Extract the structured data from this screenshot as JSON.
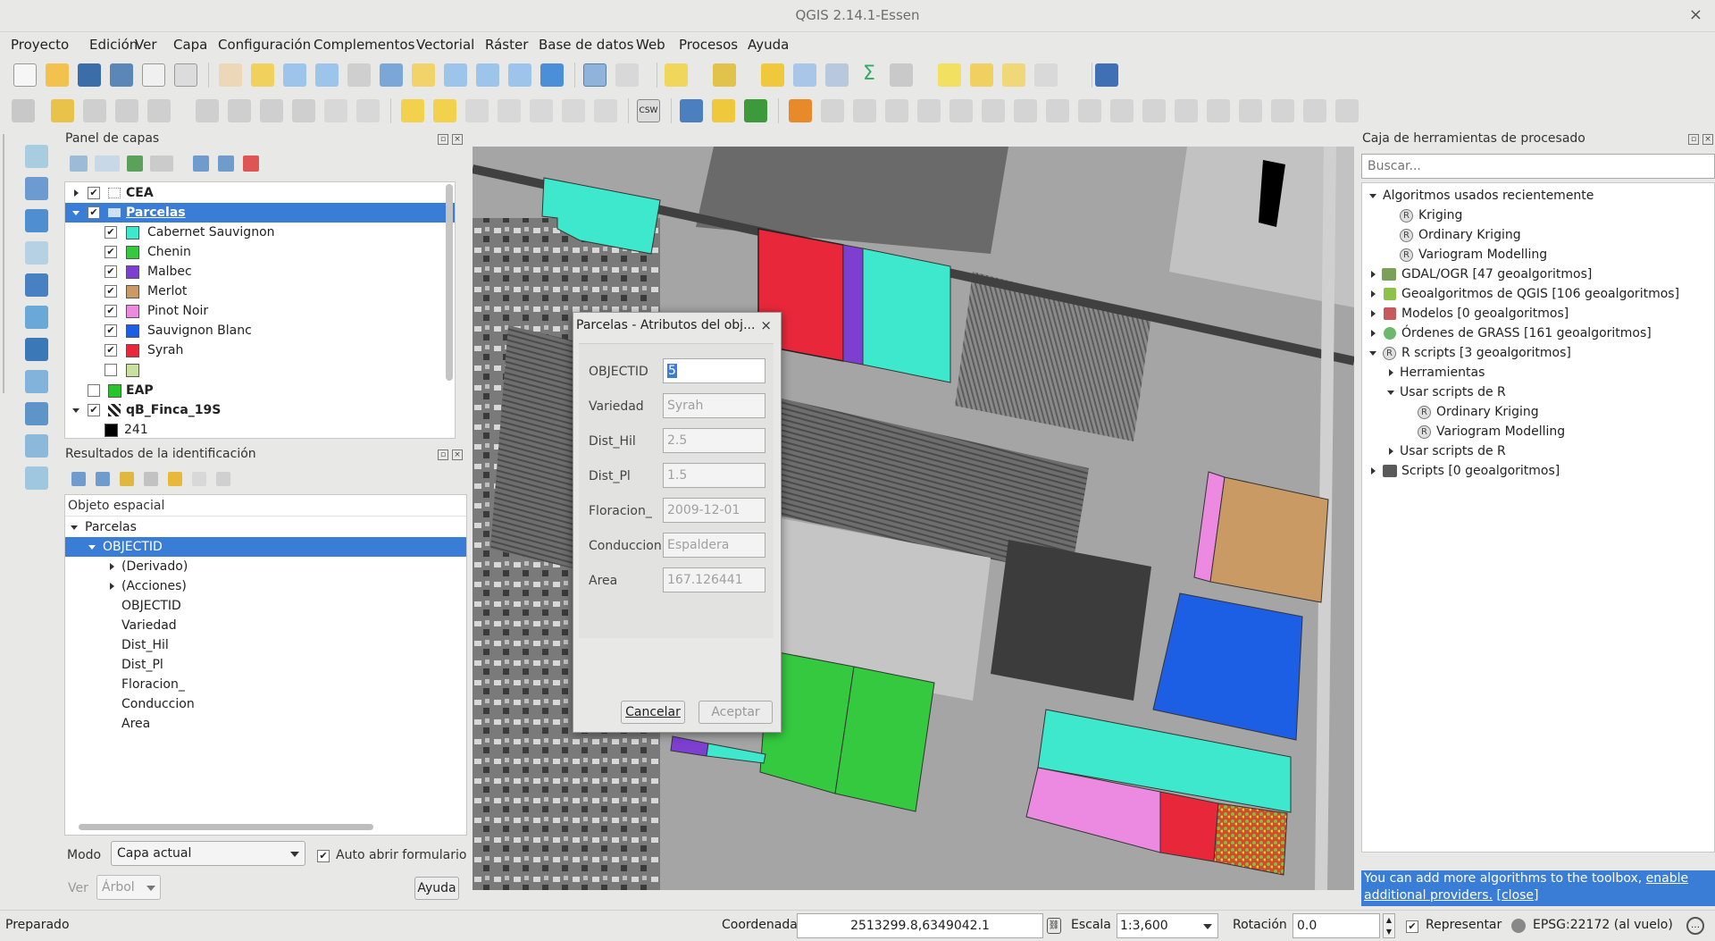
{
  "window": {
    "title": "QGIS 2.14.1-Essen",
    "close_glyph": "×"
  },
  "menu": [
    "Proyecto",
    "Edición",
    "Ver",
    "Capa",
    "Configuración",
    "Complementos",
    "Vectorial",
    "Ráster",
    "Base de datos",
    "Web",
    "Procesos",
    "Ayuda"
  ],
  "layers_panel": {
    "title": "Panel de capas",
    "layers": [
      {
        "name": "CEA",
        "checked": true,
        "expanded": false
      },
      {
        "name": "Parcelas",
        "checked": true,
        "expanded": true,
        "selected": true
      },
      {
        "name": "EAP",
        "checked": false
      },
      {
        "name": "qB_Finca_19S",
        "checked": true,
        "expanded": true
      }
    ],
    "legend": [
      {
        "label": "Cabernet Sauvignon",
        "color": "#3de8cc",
        "checked": true
      },
      {
        "label": "Chenin",
        "color": "#34c93f",
        "checked": true
      },
      {
        "label": "Malbec",
        "color": "#7d3fd0",
        "checked": true
      },
      {
        "label": "Merlot",
        "color": "#c99a64",
        "checked": true
      },
      {
        "label": "Pinot Noir",
        "color": "#ec89e0",
        "checked": true
      },
      {
        "label": "Sauvignon Blanc",
        "color": "#1d5fe4",
        "checked": true
      },
      {
        "label": "Syrah",
        "color": "#e8283a",
        "checked": true
      },
      {
        "label": "",
        "color": "#c8e0a0",
        "checked": false
      }
    ],
    "eap_color": "#27c42c",
    "raster_value": "241"
  },
  "identify_panel": {
    "title": "Resultados de la identificación",
    "header": "Objeto espacial",
    "layer": "Parcelas",
    "selected_field": "OBJECTID",
    "children": [
      "(Derivado)",
      "(Acciones)"
    ],
    "fields": [
      "OBJECTID",
      "Variedad",
      "Dist_Hil",
      "Dist_Pl",
      "Floracion_",
      "Conduccion",
      "Area"
    ],
    "mode_label": "Modo",
    "mode_value": "Capa actual",
    "auto_open_label": "Auto abrir formulario",
    "auto_open_checked": true,
    "view_label": "Ver",
    "view_value": "Árbol",
    "help_button": "Ayuda"
  },
  "dialog": {
    "title": "Parcelas - Atributos del obj...",
    "close_glyph": "×",
    "fields": [
      {
        "label": "OBJECTID",
        "value": "5"
      },
      {
        "label": "Variedad",
        "value": "Syrah"
      },
      {
        "label": "Dist_Hil",
        "value": "2.5"
      },
      {
        "label": "Dist_Pl",
        "value": "1.5"
      },
      {
        "label": "Floracion_",
        "value": "2009-12-01"
      },
      {
        "label": "Conduccion",
        "value": "Espaldera"
      },
      {
        "label": "Area",
        "value": "167.126441"
      }
    ],
    "cancel": "Cancelar",
    "accept": "Aceptar"
  },
  "processing_panel": {
    "title": "Caja de herramientas de procesado",
    "search_placeholder": "Buscar...",
    "tree": [
      {
        "label": "Algoritmos usados recientemente",
        "level": 0,
        "expanded": true
      },
      {
        "label": "Kriging",
        "level": 2
      },
      {
        "label": "Ordinary Kriging",
        "level": 2
      },
      {
        "label": "Variogram Modelling",
        "level": 2
      },
      {
        "label": "GDAL/OGR [47 geoalgoritmos]",
        "level": 0,
        "expanded": false
      },
      {
        "label": "Geoalgoritmos de QGIS [106 geoalgoritmos]",
        "level": 0,
        "expanded": false
      },
      {
        "label": "Modelos [0 geoalgoritmos]",
        "level": 0,
        "expanded": false
      },
      {
        "label": "Órdenes de GRASS [161 geoalgoritmos]",
        "level": 0,
        "expanded": false
      },
      {
        "label": "R scripts [3 geoalgoritmos]",
        "level": 0,
        "expanded": true
      },
      {
        "label": "Herramientas",
        "level": 1,
        "expanded": false
      },
      {
        "label": "Usar scripts de R",
        "level": 1,
        "expanded": true
      },
      {
        "label": "Ordinary Kriging",
        "level": 3
      },
      {
        "label": "Variogram Modelling",
        "level": 3
      },
      {
        "label": "Usar scripts de R",
        "level": 1,
        "expanded": false
      },
      {
        "label": "Scripts [0 geoalgoritmos]",
        "level": 0,
        "expanded": false
      }
    ],
    "notice_text": "You can add more algorithms to the toolbox,",
    "notice_link1": "enable additional providers.",
    "notice_link2": "[close]"
  },
  "status": {
    "ready": "Preparado",
    "coord_label": "Coordenada",
    "coord_value": "2513299.8,6349042.1",
    "scale_label": "Escala",
    "scale_value": "1:3,600",
    "rotation_label": "Rotación",
    "rotation_value": "0.0",
    "render_label": "Representar",
    "render_checked": true,
    "crs": "EPSG:22172 (al vuelo)"
  }
}
